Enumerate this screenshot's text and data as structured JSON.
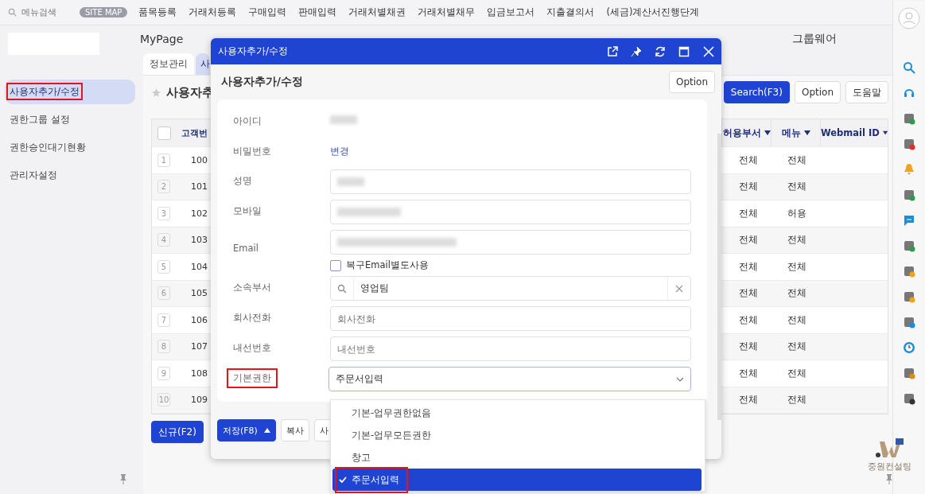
{
  "top_menu": {
    "search_placeholder": "메뉴검색",
    "site_map": "SITE MAP",
    "items": [
      "품목등록",
      "거래처등록",
      "구매입력",
      "판매입력",
      "거래처별채권",
      "거래처별채무",
      "입금보고서",
      "지출결의서",
      "(세금)계산서진행단계"
    ]
  },
  "header": {
    "nav": [
      "MyPage",
      "그룹웨어"
    ]
  },
  "tabs": [
    {
      "label": "정보관리",
      "selected": false
    },
    {
      "label": "사",
      "selected": true
    }
  ],
  "sidebar": {
    "items": [
      {
        "label": "사용자추가/수정",
        "selected": true,
        "annotated": true
      },
      {
        "label": "권한그룹 설정",
        "selected": false,
        "annotated": false
      },
      {
        "label": "권한승인대기현황",
        "selected": false,
        "annotated": false
      },
      {
        "label": "관리자설정",
        "selected": false,
        "annotated": false
      }
    ]
  },
  "page": {
    "title": "사용자추",
    "buttons": [
      {
        "label": "Search(F3)",
        "kind": "primary"
      },
      {
        "label": "Option",
        "kind": "plain"
      },
      {
        "label": "도움말",
        "kind": "plain"
      }
    ]
  },
  "table": {
    "select_all_checked": false,
    "columns": [
      "고객번",
      "허용부서",
      "메뉴",
      "Webmail ID"
    ],
    "rows": [
      {
        "index": "1",
        "id": "100",
        "dept": "전체",
        "menu": "전체"
      },
      {
        "index": "2",
        "id": "101",
        "dept": "전체",
        "menu": "전체"
      },
      {
        "index": "3",
        "id": "102",
        "dept": "전체",
        "menu": "허용"
      },
      {
        "index": "4",
        "id": "103",
        "dept": "전체",
        "menu": "전체"
      },
      {
        "index": "5",
        "id": "104",
        "dept": "전체",
        "menu": "전체"
      },
      {
        "index": "6",
        "id": "105",
        "dept": "전체",
        "menu": "전체"
      },
      {
        "index": "7",
        "id": "106",
        "dept": "전체",
        "menu": "전체"
      },
      {
        "index": "8",
        "id": "107",
        "dept": "전체",
        "menu": "전체"
      },
      {
        "index": "9",
        "id": "108",
        "dept": "전체",
        "menu": "전체"
      },
      {
        "index": "10",
        "id": "109",
        "dept": "전체",
        "menu": "전체"
      }
    ]
  },
  "bottom_buttons": [
    {
      "label": "신규(F2)",
      "kind": "primary"
    }
  ],
  "modal": {
    "title": "사용자추가/수정",
    "heading": "사용자추가/수정",
    "option_button": "Option",
    "fields": [
      {
        "label": "아이디",
        "kind": "redacted",
        "annotated": false
      },
      {
        "label": "비밀번호",
        "kind": "link",
        "value": "변경",
        "annotated": false
      },
      {
        "label": "성명",
        "kind": "redacted-input",
        "annotated": false
      },
      {
        "label": "모바일",
        "kind": "redacted-input",
        "annotated": false
      },
      {
        "label": "Email",
        "kind": "email",
        "checkbox": {
          "label": "복구Email별도사용",
          "checked": false
        },
        "annotated": false
      },
      {
        "label": "소속부서",
        "kind": "search",
        "value": "영업팀",
        "annotated": false
      },
      {
        "label": "회사전화",
        "kind": "input",
        "placeholder": "회사전화",
        "annotated": false
      },
      {
        "label": "내선번호",
        "kind": "input",
        "placeholder": "내선번호",
        "annotated": false
      },
      {
        "label": "기본권한",
        "kind": "select",
        "value": "주문서입력",
        "annotated": true
      }
    ],
    "footer_buttons": [
      {
        "label": "저장(F8)",
        "kind": "primary"
      },
      {
        "label": "복사",
        "kind": "plain"
      },
      {
        "label": "사",
        "kind": "plain"
      }
    ],
    "dropdown": [
      {
        "label": "기본-업무권한없음",
        "selected": false,
        "annotated": false
      },
      {
        "label": "기본-업무모든권한",
        "selected": false,
        "annotated": false
      },
      {
        "label": "창고",
        "selected": false,
        "annotated": false
      },
      {
        "label": "주문서입력",
        "selected": true,
        "annotated": true
      }
    ]
  },
  "brand": {
    "name": "중원컨설팅"
  }
}
